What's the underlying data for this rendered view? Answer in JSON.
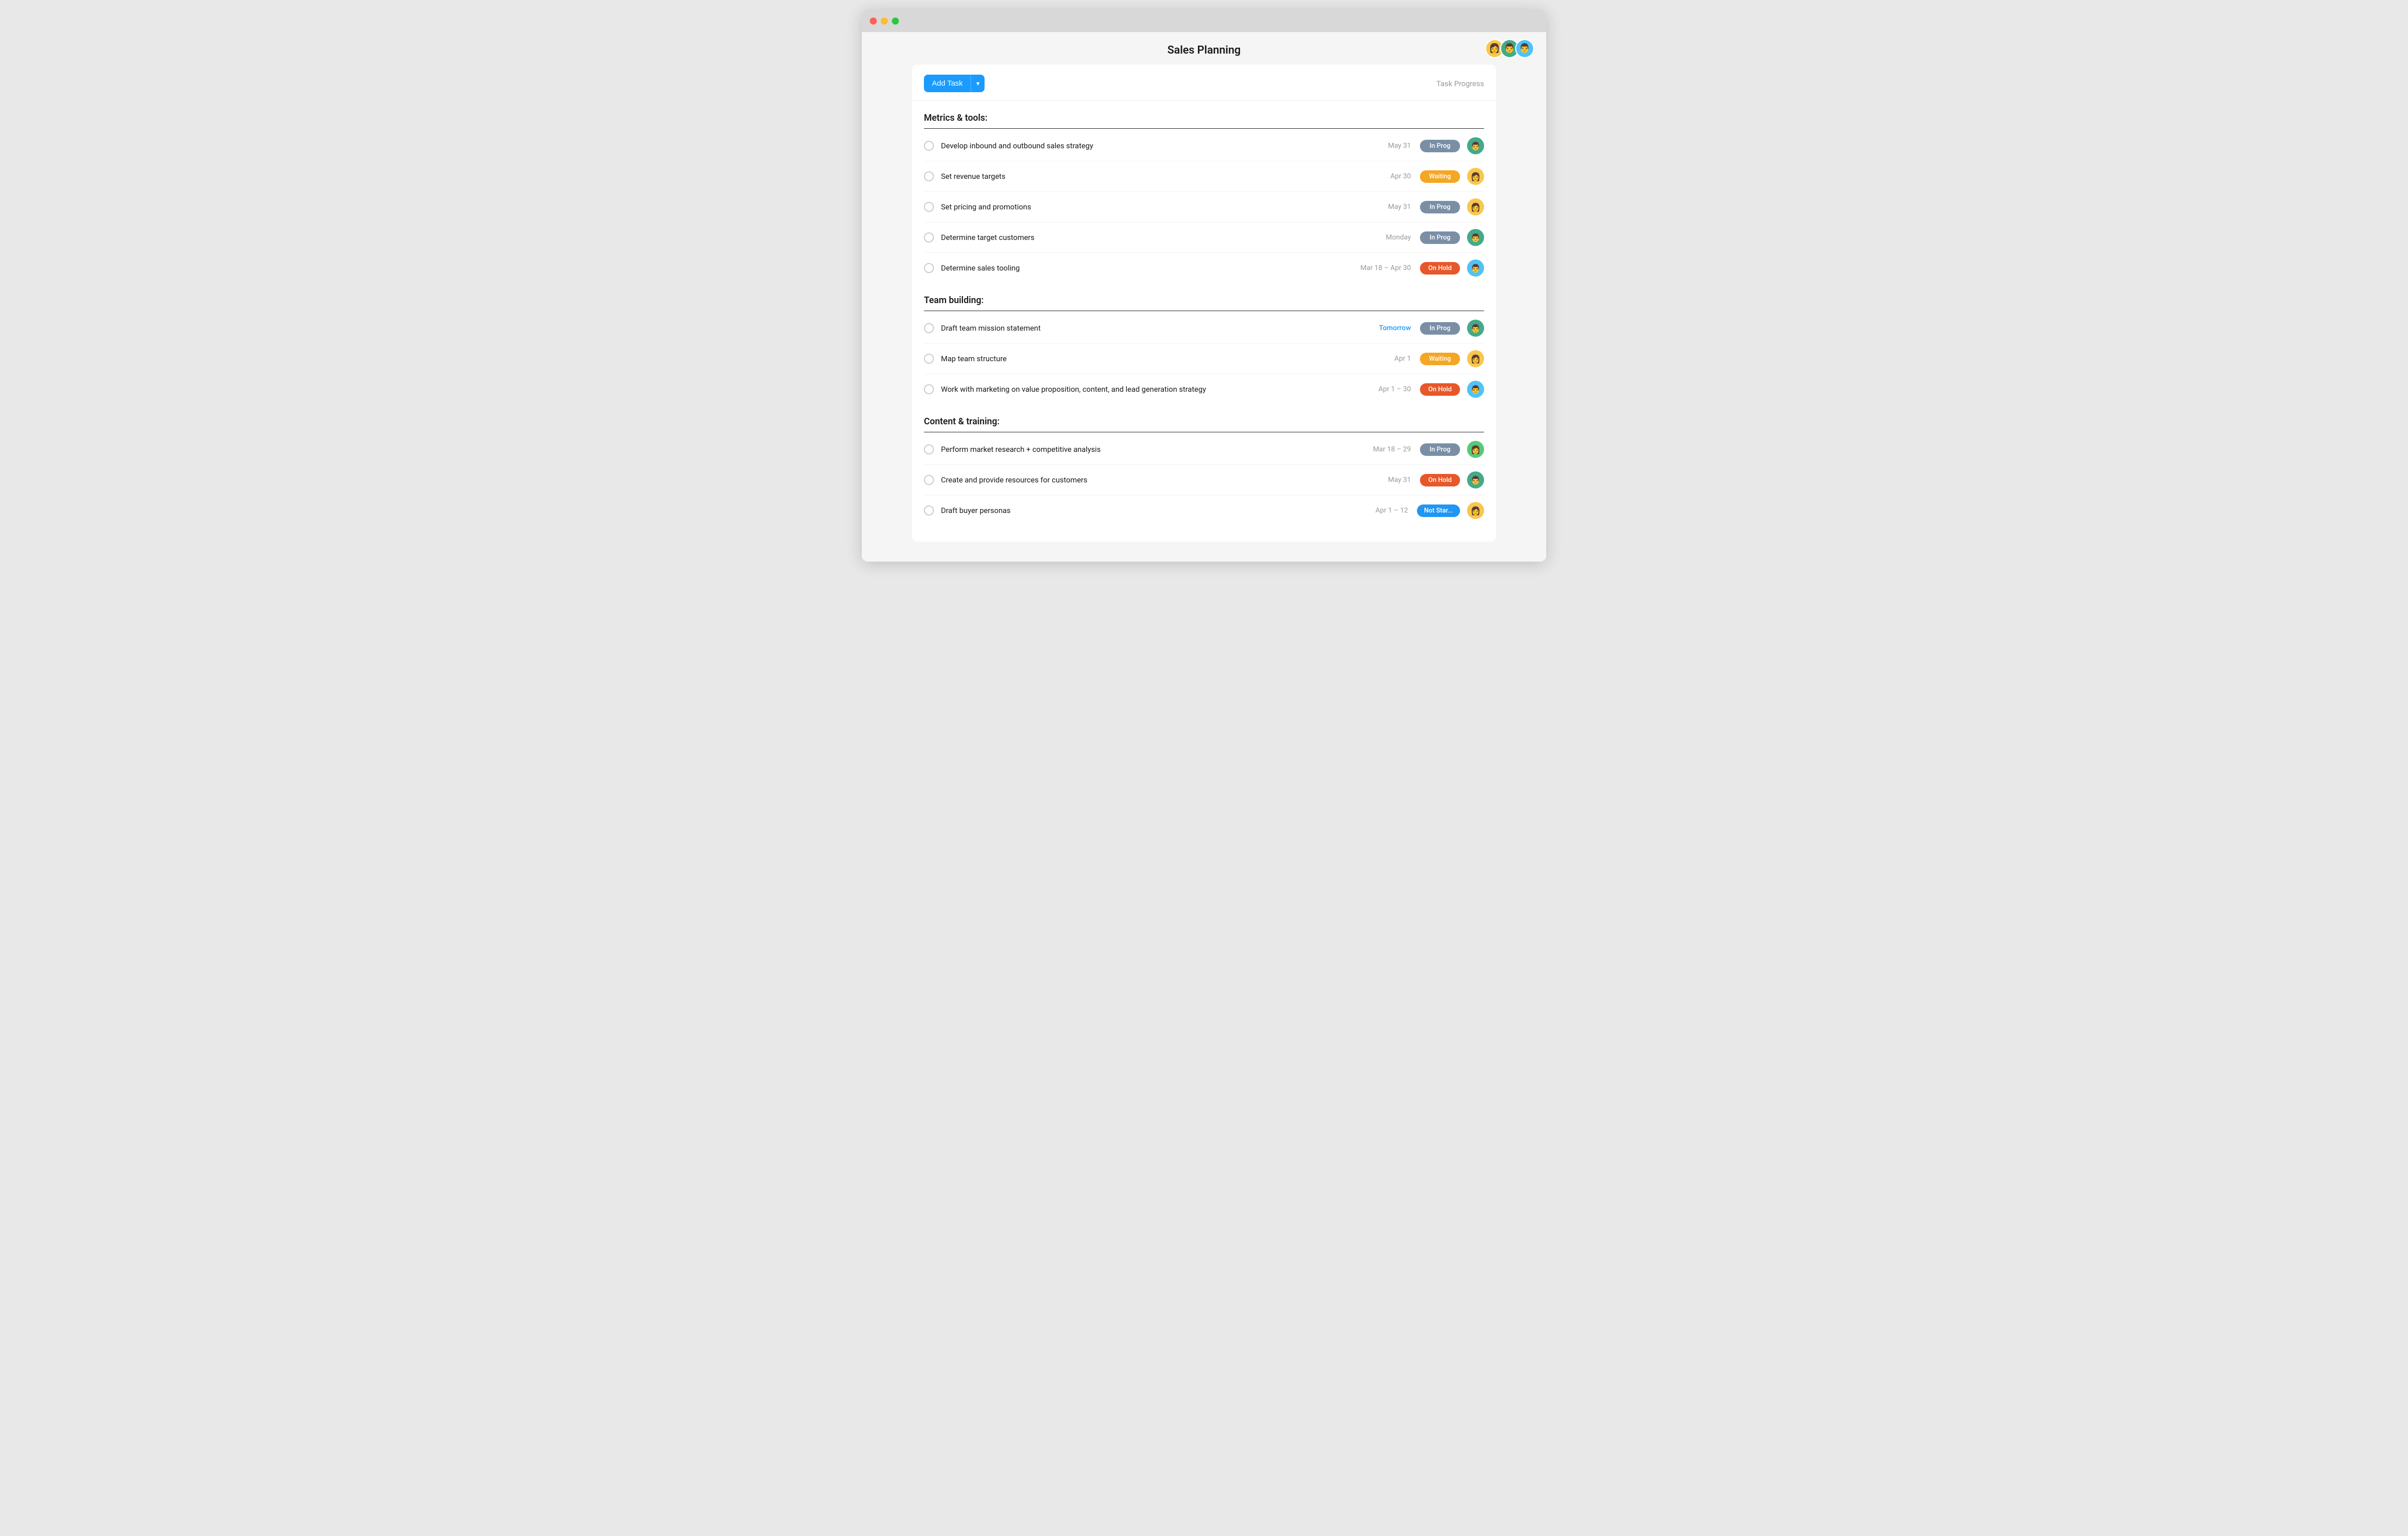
{
  "window": {
    "title": "Sales Planning"
  },
  "header": {
    "title": "Sales Planning",
    "avatars": [
      {
        "color": "av-yellow",
        "emoji": "👩"
      },
      {
        "color": "av-teal",
        "emoji": "👨"
      },
      {
        "color": "av-blue",
        "emoji": "👨"
      }
    ]
  },
  "toolbar": {
    "add_task_label": "Add Task",
    "task_progress_label": "Task Progress"
  },
  "sections": [
    {
      "title": "Metrics & tools:",
      "tasks": [
        {
          "name": "Develop inbound and outbound sales strategy",
          "date": "May 31",
          "date_class": "",
          "status": "In Prog",
          "status_class": "status-inprog",
          "avatar_class": "av-teal",
          "avatar_emoji": "👨"
        },
        {
          "name": "Set revenue targets",
          "date": "Apr 30",
          "date_class": "",
          "status": "Waiting",
          "status_class": "status-waiting",
          "avatar_class": "av-yellow",
          "avatar_emoji": "👩"
        },
        {
          "name": "Set pricing and promotions",
          "date": "May 31",
          "date_class": "",
          "status": "In Prog",
          "status_class": "status-inprog",
          "avatar_class": "av-yellow",
          "avatar_emoji": "👩"
        },
        {
          "name": "Determine target customers",
          "date": "Monday",
          "date_class": "",
          "status": "In Prog",
          "status_class": "status-inprog",
          "avatar_class": "av-teal",
          "avatar_emoji": "👨"
        },
        {
          "name": "Determine sales tooling",
          "date": "Mar 18 – Apr 30",
          "date_class": "",
          "status": "On Hold",
          "status_class": "status-onhold",
          "avatar_class": "av-blue",
          "avatar_emoji": "👨"
        }
      ]
    },
    {
      "title": "Team building:",
      "tasks": [
        {
          "name": "Draft team mission statement",
          "date": "Tomorrow",
          "date_class": "tomorrow",
          "status": "In Prog",
          "status_class": "status-inprog",
          "avatar_class": "av-teal",
          "avatar_emoji": "👨"
        },
        {
          "name": "Map team structure",
          "date": "Apr 1",
          "date_class": "",
          "status": "Waiting",
          "status_class": "status-waiting",
          "avatar_class": "av-yellow",
          "avatar_emoji": "👩"
        },
        {
          "name": "Work with marketing on value proposition, content, and lead generation strategy",
          "date": "Apr 1 – 30",
          "date_class": "",
          "status": "On Hold",
          "status_class": "status-onhold",
          "avatar_class": "av-blue",
          "avatar_emoji": "👨"
        }
      ]
    },
    {
      "title": "Content & training:",
      "tasks": [
        {
          "name": "Perform market research + competitive analysis",
          "date": "Mar 18 – 29",
          "date_class": "",
          "status": "In Prog",
          "status_class": "status-inprog",
          "avatar_class": "av-green",
          "avatar_emoji": "👩"
        },
        {
          "name": "Create and provide resources for customers",
          "date": "May 31",
          "date_class": "",
          "status": "On Hold",
          "status_class": "status-onhold",
          "avatar_class": "av-teal",
          "avatar_emoji": "👨"
        },
        {
          "name": "Draft buyer personas",
          "date": "Apr 1 – 12",
          "date_class": "",
          "status": "Not Star...",
          "status_class": "status-notstar",
          "avatar_class": "av-yellow",
          "avatar_emoji": "👩"
        }
      ]
    }
  ]
}
